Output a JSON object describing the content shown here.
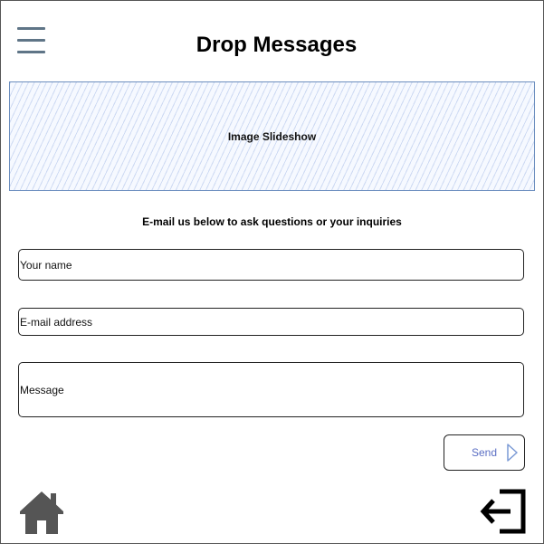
{
  "header": {
    "title": "Drop Messages",
    "menu_icon": "hamburger-menu-icon"
  },
  "slideshow": {
    "label": "Image Slideshow"
  },
  "contact": {
    "intro": "E-mail us below to ask questions or your inquiries",
    "name_placeholder": "Your name",
    "email_placeholder": "E-mail address",
    "message_placeholder": "Message",
    "send_label": "Send",
    "send_icon": "play-triangle-icon"
  },
  "footer": {
    "home_icon": "home-icon",
    "logout_icon": "logout-icon"
  },
  "colors": {
    "menu_icon": "#5f7587",
    "slideshow_border": "#6c8ebf",
    "send_text": "#5b6fc4",
    "home_icon": "#555555"
  }
}
